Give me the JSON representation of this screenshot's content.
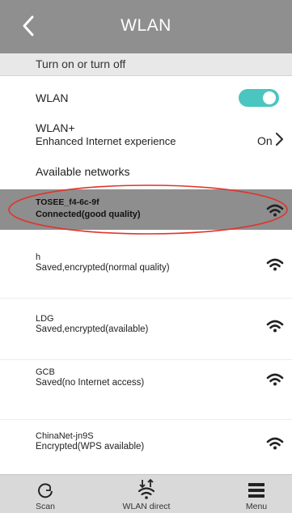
{
  "header": {
    "title": "WLAN",
    "back_icon": "chevron-left-icon"
  },
  "section": {
    "label": "Turn on or turn off"
  },
  "wlan": {
    "label": "WLAN",
    "enabled": true,
    "toggle_color": "#4bc5bf"
  },
  "wlan_plus": {
    "title": "WLAN+",
    "subtitle": "Enhanced Internet experience",
    "value": "On"
  },
  "available": {
    "label": "Available networks"
  },
  "networks": [
    {
      "name": "TOSEE_f4-6c-9f",
      "status": "Connected(good quality)",
      "connected": true
    },
    {
      "name": "h",
      "status": "Saved,encrypted(normal quality)"
    },
    {
      "name": "LDG",
      "status": "Saved,encrypted(available)"
    },
    {
      "name": "GCB",
      "status": "Saved(no Internet access)"
    },
    {
      "name": "ChinaNet-jn9S",
      "status": "Encrypted(WPS available)"
    }
  ],
  "bottom_bar": {
    "scan": {
      "label": "Scan",
      "icon": "refresh-icon"
    },
    "wlan_direct": {
      "label": "WLAN direct",
      "icon": "wifi-direct-icon"
    },
    "menu": {
      "label": "Menu",
      "icon": "menu-icon"
    }
  },
  "colors": {
    "header": "#8f8f8f",
    "connected_row": "#8e8e8e",
    "highlight_ellipse": "#e0342c"
  }
}
